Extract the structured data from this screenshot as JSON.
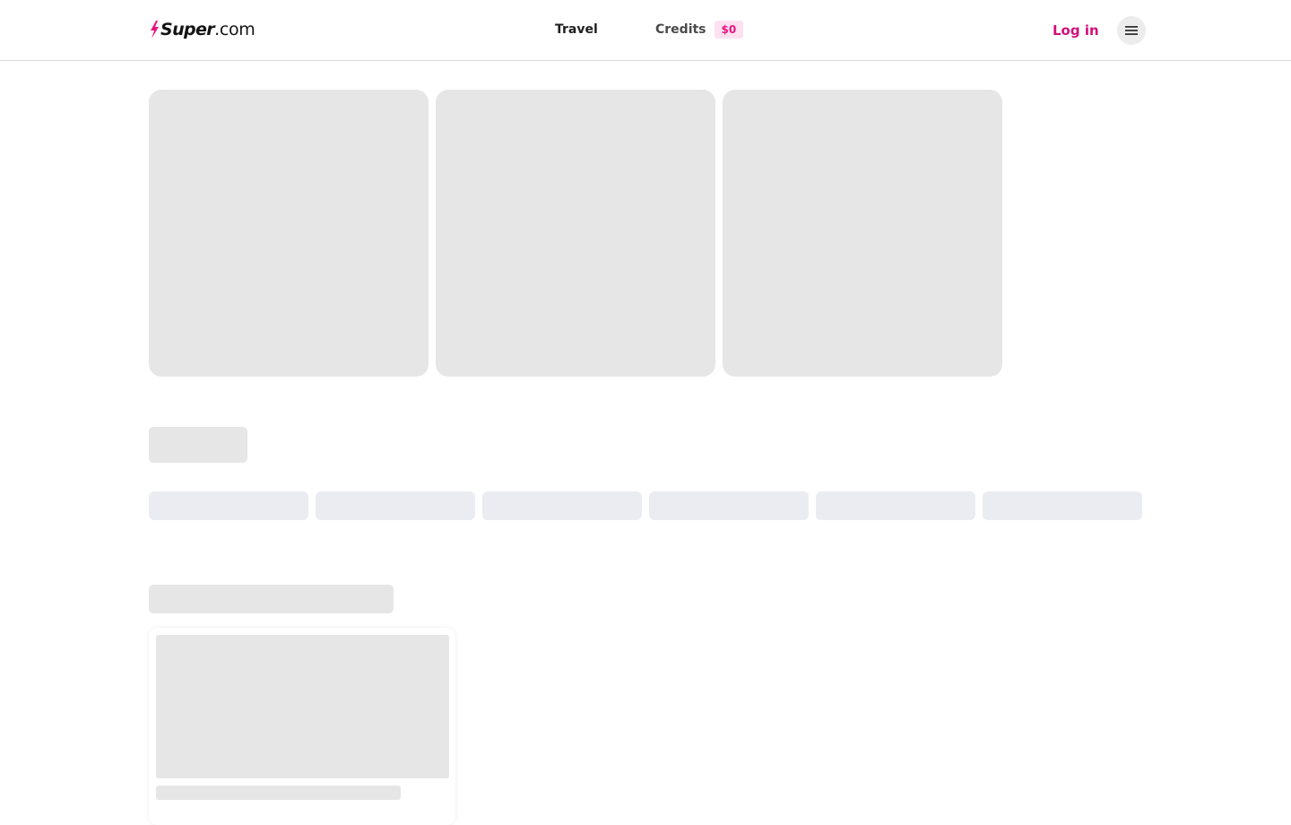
{
  "brand": {
    "name_main": "Super",
    "name_suffix": ".com",
    "accent_color": "#e6157f"
  },
  "nav": {
    "travel_label": "Travel",
    "credits_label": "Credits",
    "credits_balance": "$0"
  },
  "account": {
    "login_label": "Log in",
    "menu_icon": "hamburger-menu-icon"
  },
  "loading_state": {
    "hero_cards": 3,
    "category_chips": 6,
    "deal_cards": 1
  }
}
